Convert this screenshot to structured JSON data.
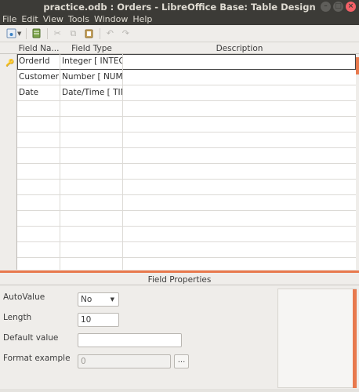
{
  "window": {
    "title": "practice.odb : Orders - LibreOffice Base: Table Design"
  },
  "menu": [
    "File",
    "Edit",
    "View",
    "Tools",
    "Window",
    "Help"
  ],
  "toolbar": {
    "icons": [
      "save-icon",
      "view-design-icon",
      "cut-icon",
      "copy-icon",
      "paste-icon",
      "undo-icon",
      "redo-icon"
    ]
  },
  "grid": {
    "columns": [
      "Field Na...",
      "Field Type",
      "Description"
    ],
    "rows": [
      {
        "name": "OrderId",
        "type": "Integer [ INTEGER ]",
        "description": ""
      },
      {
        "name": "CustomerId",
        "type": "Number [ NUMERIC ]",
        "description": ""
      },
      {
        "name": "Date",
        "type": "Date/Time [ TIMESTAMP ]",
        "description": ""
      }
    ]
  },
  "properties": {
    "title": "Field Properties",
    "autovalue_label": "AutoValue",
    "autovalue_value": "No",
    "length_label": "Length",
    "length_value": "10",
    "default_label": "Default value",
    "default_value": "",
    "format_label": "Format example",
    "format_value": "0",
    "format_button": "..."
  },
  "colors": {
    "accent": "#e8794d",
    "titlebar": "#3c3b37"
  }
}
